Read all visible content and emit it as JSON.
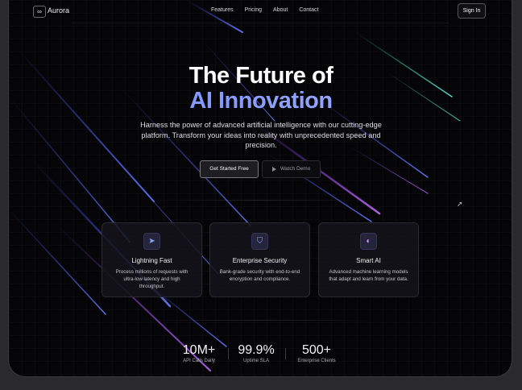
{
  "brand": {
    "logo_icon": "∞",
    "name": "Aurora"
  },
  "nav": {
    "items": [
      "Features",
      "Pricing",
      "About",
      "Contact"
    ],
    "sign_in": "Sign In"
  },
  "hero": {
    "title_line1": "The Future of",
    "title_line2": "AI Innovation",
    "subtitle": "Harness the power of advanced artificial intelligence with our cutting-edge platform. Transform your ideas into reality with unprecedented speed and precision.",
    "cta_primary": "Get Started Free",
    "cta_secondary": "Watch Demo"
  },
  "features": [
    {
      "icon": "rocket-icon",
      "glyph": "➤",
      "title": "Lightning Fast",
      "description": "Process millions of requests with ultra-low latency and high throughput."
    },
    {
      "icon": "shield-icon",
      "glyph": "⛉",
      "title": "Enterprise Security",
      "description": "Bank-grade security with end-to-end encryption and compliance."
    },
    {
      "icon": "brain-icon",
      "glyph": "◐",
      "title": "Smart AI",
      "description": "Advanced machine learning models that adapt and learn from your data."
    }
  ],
  "stats": [
    {
      "value": "10M+",
      "label": "API Calls Daily"
    },
    {
      "value": "99.9%",
      "label": "Uptime SLA"
    },
    {
      "value": "500+",
      "label": "Enterprise Clients"
    }
  ],
  "colors": {
    "accent": "#6f86ff",
    "background": "#050507"
  }
}
